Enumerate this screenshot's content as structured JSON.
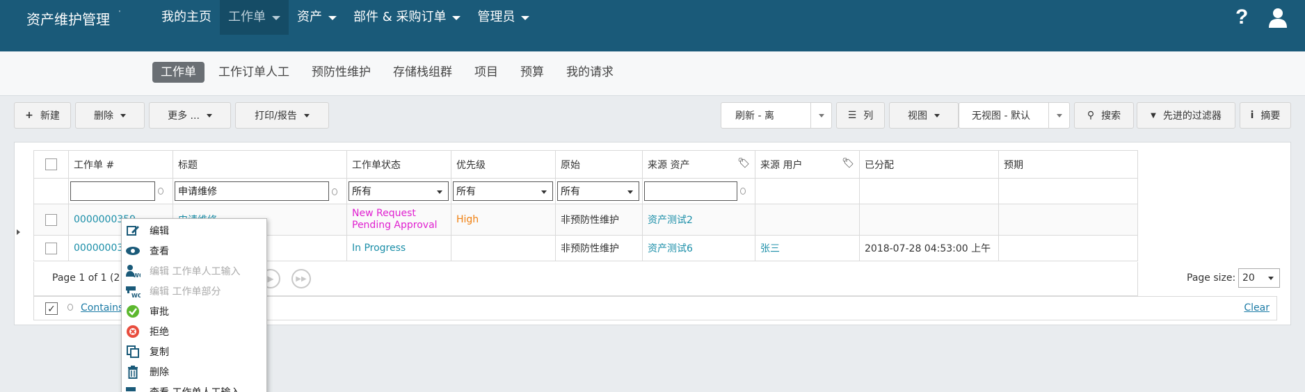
{
  "header": {
    "brand": "资产维护管理",
    "brand_mark": "'",
    "nav": [
      {
        "label": "我的主页",
        "dropdown": false,
        "active": false
      },
      {
        "label": "工作单",
        "dropdown": true,
        "active": true
      },
      {
        "label": "资产",
        "dropdown": true,
        "active": false
      },
      {
        "label": "部件 & 采购订单",
        "dropdown": true,
        "active": false
      },
      {
        "label": "管理员",
        "dropdown": true,
        "active": false
      }
    ],
    "help_icon": "?"
  },
  "subnav": [
    {
      "label": "工作单",
      "active": true
    },
    {
      "label": "工作订单人工",
      "active": false
    },
    {
      "label": "预防性维护",
      "active": false
    },
    {
      "label": "存储栈组群",
      "active": false
    },
    {
      "label": "项目",
      "active": false
    },
    {
      "label": "预算",
      "active": false
    },
    {
      "label": "我的请求",
      "active": false
    }
  ],
  "toolbar": {
    "new_icon": "+",
    "new_label": "新建",
    "delete_label": "删除",
    "more_label": "更多 ...",
    "print_label": "打印/报告",
    "refresh_label": "刷新 - 离",
    "columns_icon": "☰",
    "columns_label": "列",
    "view_label": "视图",
    "view_select": "无视图 - 默认",
    "search_icon": "⚲",
    "search_label": "搜索",
    "filter_icon": "▼",
    "filter_label": "先进的过滤器",
    "summary_icon": "i",
    "summary_label": "摘要"
  },
  "grid": {
    "columns": [
      "工作单 #",
      "标题",
      "工作单状态",
      "优先级",
      "原始",
      "来源 资产",
      "来源 用户",
      "已分配",
      "预期"
    ],
    "filters": {
      "wo_number": "",
      "title": "申请维修",
      "status": "所有",
      "priority": "所有",
      "origin": "所有",
      "asset": ""
    },
    "rows": [
      {
        "wo": "0000000359",
        "title": "申请维修",
        "status": "New Request Pending Approval",
        "status_line1": "New Request",
        "status_line2": "Pending Approval",
        "priority": "High",
        "origin": "非预防性维护",
        "asset": "资产测试2",
        "user": "",
        "assigned": "",
        "expected": ""
      },
      {
        "wo": "00000003",
        "title": "",
        "status": "In Progress",
        "priority": "",
        "origin": "非预防性维护",
        "asset": "资产测试6",
        "user": "张三",
        "assigned": "2018-07-28 04:53:00 上午",
        "expected": ""
      }
    ],
    "status_colors": {
      "new_request": "#e020d0",
      "in_progress": "#1a8ea8",
      "high": "#f08010"
    }
  },
  "pager": {
    "info": "Page 1 of 1 (2",
    "next_icon": "▶",
    "last_icon": "▶▶",
    "page_size_label": "Page size:",
    "page_size": "20"
  },
  "filterbar": {
    "checkbox_glyph": "✓",
    "contains_label": "Contains",
    "clear_label": "Clear"
  },
  "context_menu": [
    {
      "label": "编辑",
      "icon": "edit-icon",
      "disabled": false
    },
    {
      "label": "查看",
      "icon": "eye-icon",
      "disabled": false
    },
    {
      "label": "编辑 工作单人工输入",
      "icon": "wo-labor-icon",
      "disabled": true
    },
    {
      "label": "编辑 工作单部分",
      "icon": "wo-parts-icon",
      "disabled": true
    },
    {
      "label": "审批",
      "icon": "approve-icon",
      "disabled": false
    },
    {
      "label": "拒绝",
      "icon": "reject-icon",
      "disabled": false
    },
    {
      "label": "复制",
      "icon": "copy-icon",
      "disabled": false
    },
    {
      "label": "删除",
      "icon": "trash-icon",
      "disabled": false
    },
    {
      "label": "查看 工作单人工输入",
      "icon": "wo-labor-view-icon",
      "disabled": false
    }
  ]
}
